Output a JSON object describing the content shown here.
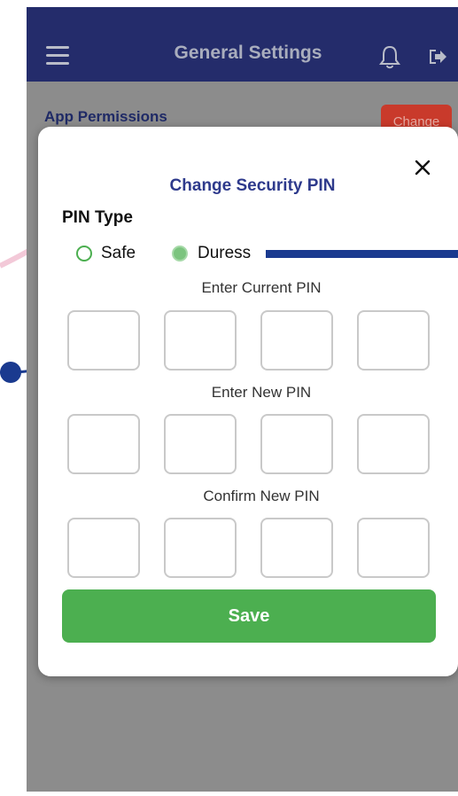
{
  "header": {
    "title": "General Settings",
    "menu_icon": "hamburger-menu-icon",
    "bell_icon": "bell-icon",
    "logout_icon": "logout-icon"
  },
  "background_section": {
    "label": "App Permissions",
    "change_button": "Change"
  },
  "modal": {
    "title": "Change Security PIN",
    "close_icon": "close-icon",
    "pin_type_label": "PIN Type",
    "options": [
      {
        "label": "Safe",
        "selected": false
      },
      {
        "label": "Duress",
        "selected": true
      }
    ],
    "current_pin_label": "Enter Current PIN",
    "new_pin_label": "Enter New PIN",
    "confirm_pin_label": "Confirm New PIN",
    "pin_length": 4,
    "save_label": "Save"
  },
  "colors": {
    "header": "#242c6b",
    "accent_green": "#4caf50",
    "title_blue": "#2e3a8c",
    "change_red": "#c93a2b"
  }
}
